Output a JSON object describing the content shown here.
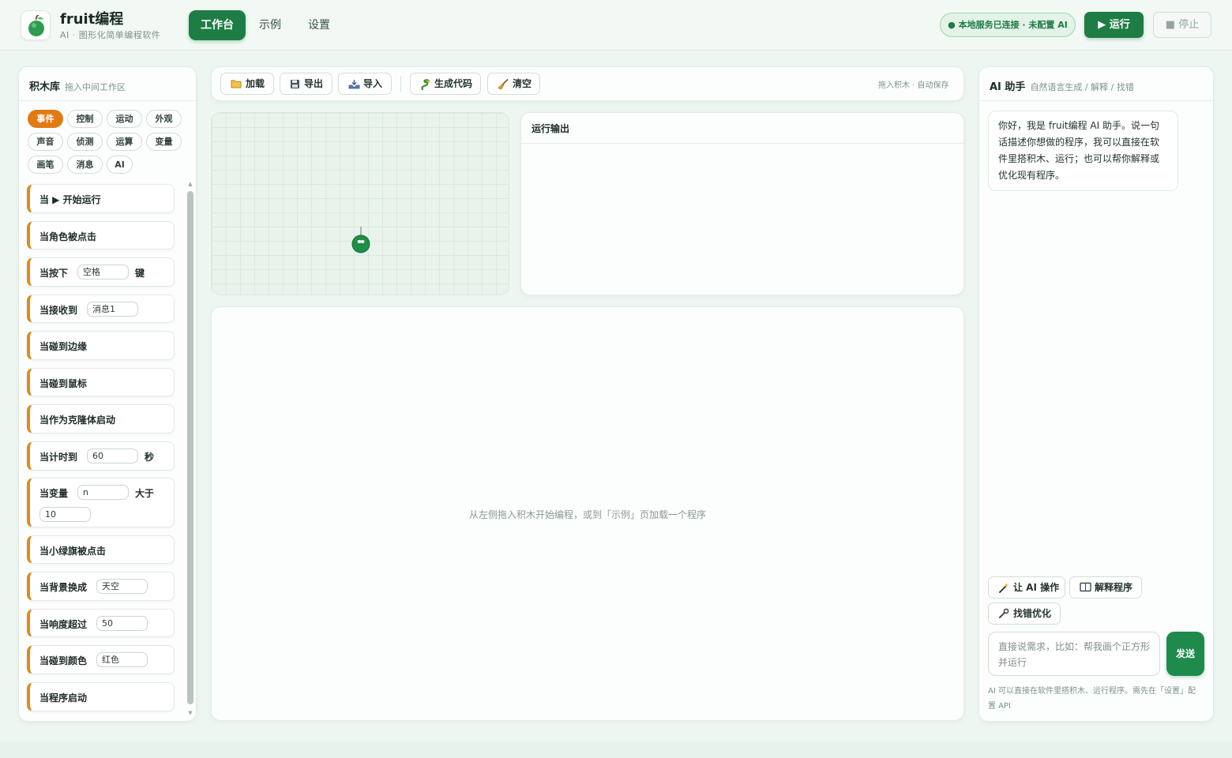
{
  "app": {
    "name": "fruit编程",
    "subtitle": "AI · 图形化简单编程软件"
  },
  "nav": {
    "tabs": [
      "工作台",
      "示例",
      "设置"
    ]
  },
  "header": {
    "status": "● 本地服务已连接 · 未配置 AI",
    "run": "▶ 运行",
    "stop": "■ 停止"
  },
  "library": {
    "title": "积木库",
    "hint": "拖入中间工作区",
    "categories": [
      "事件",
      "控制",
      "运动",
      "外观",
      "声音",
      "侦测",
      "运算",
      "变量",
      "画笔",
      "消息",
      "AI"
    ],
    "blocks": {
      "b1": "当 ▶ 开始运行",
      "b2": "当角色被点击",
      "b3": "当按下",
      "b3_val": "空格",
      "b3_tail": "键",
      "b4": "当接收到",
      "b4_val": "消息1",
      "b5": "当碰到边缘",
      "b6": "当碰到鼠标",
      "b7": "当作为克隆体启动",
      "b8": "当计时到",
      "b8_val": "60",
      "b8_tail": "秒",
      "b9": "当变量",
      "b9_val": "n",
      "b9_mid": "大于",
      "b9_val2": "10",
      "b10": "当小绿旗被点击",
      "b11": "当背景换成",
      "b11_val": "天空",
      "b12": "当响度超过",
      "b12_val": "50",
      "b13": "当碰到颜色",
      "b13_val": "红色",
      "b14": "当程序启动"
    }
  },
  "toolbar": {
    "load": "加载",
    "export": "导出",
    "import": "导入",
    "gen_code": "生成代码",
    "clear": "清空",
    "hint": "拖入积木 · 自动保存"
  },
  "output": {
    "title": "运行输出"
  },
  "workspace": {
    "empty": "从左侧拖入积木开始编程，或到「示例」页加载一个程序"
  },
  "ai": {
    "title": "AI 助手",
    "hint": "自然语言生成 / 解释 / 找错",
    "greeting": "你好，我是 fruit编程 AI 助手。说一句话描述你想做的程序，我可以直接在软件里搭积木、运行；也可以帮你解释或优化现有程序。",
    "actions": {
      "operate": "让 AI 操作",
      "explain": "解释程序",
      "debug": "找错优化"
    },
    "input_placeholder": "直接说需求，比如：帮我画个正方形并运行",
    "send": "发送",
    "footnote": "AI 可以直接在软件里搭积木、运行程序。需先在「设置」配置 API"
  },
  "colors": {
    "primary": "#1e7c45",
    "event_orange": "#e07b14",
    "background": "#eef6f1"
  }
}
